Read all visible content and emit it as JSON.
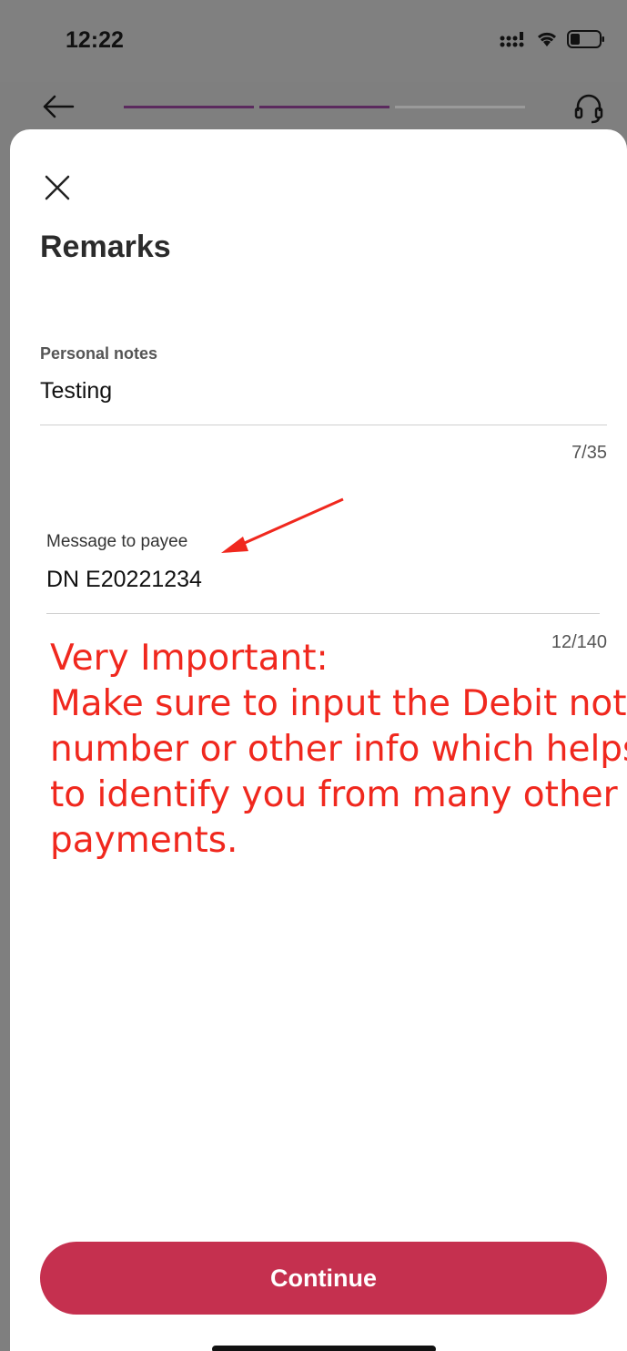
{
  "status_bar": {
    "time": "12:22"
  },
  "header": {
    "progress_steps": 3,
    "progress_active": 2
  },
  "sheet": {
    "title": "Remarks"
  },
  "personal_notes": {
    "label": "Personal notes",
    "value": "Testing",
    "counter": "7/35"
  },
  "message_to_payee": {
    "label": "Message to payee",
    "value": "DN E20221234",
    "counter": "12/140"
  },
  "annotation": {
    "line1": "Very Important:",
    "line2": "Make sure to input the Debit note",
    "line3": "number or other info which helps",
    "line4": "to identify you from many other",
    "line5": "payments."
  },
  "continue_button": {
    "label": "Continue"
  },
  "colors": {
    "accent": "#c5304f",
    "progress_active": "#5b2a5e",
    "annotation": "#f0281e"
  }
}
